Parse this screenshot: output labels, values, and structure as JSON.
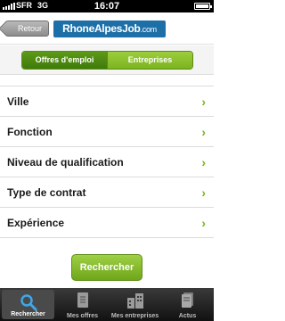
{
  "status_bar": {
    "carrier": "SFR",
    "network": "3G",
    "time": "16:07"
  },
  "header": {
    "back_label": "Retour",
    "logo": {
      "name": "RhoneAlpesJob",
      "domain": ".com"
    }
  },
  "segments": [
    {
      "label": "Offres d'emploi",
      "selected": true
    },
    {
      "label": "Entreprises",
      "selected": false
    }
  ],
  "criteria": [
    {
      "label": "Ville"
    },
    {
      "label": "Fonction"
    },
    {
      "label": "Niveau de qualification"
    },
    {
      "label": "Type de contrat"
    },
    {
      "label": "Expérience"
    }
  ],
  "search_button": {
    "label": "Rechercher"
  },
  "tab_bar": [
    {
      "label": "Rechercher",
      "icon": "search-icon",
      "active": true
    },
    {
      "label": "Mes offres",
      "icon": "document-icon",
      "active": false
    },
    {
      "label": "Mes entreprises",
      "icon": "buildings-icon",
      "active": false
    },
    {
      "label": "Actus",
      "icon": "news-icon",
      "active": false
    }
  ],
  "colors": {
    "accent_green": "#7ab51d",
    "logo_blue": "#1d6fa7"
  }
}
